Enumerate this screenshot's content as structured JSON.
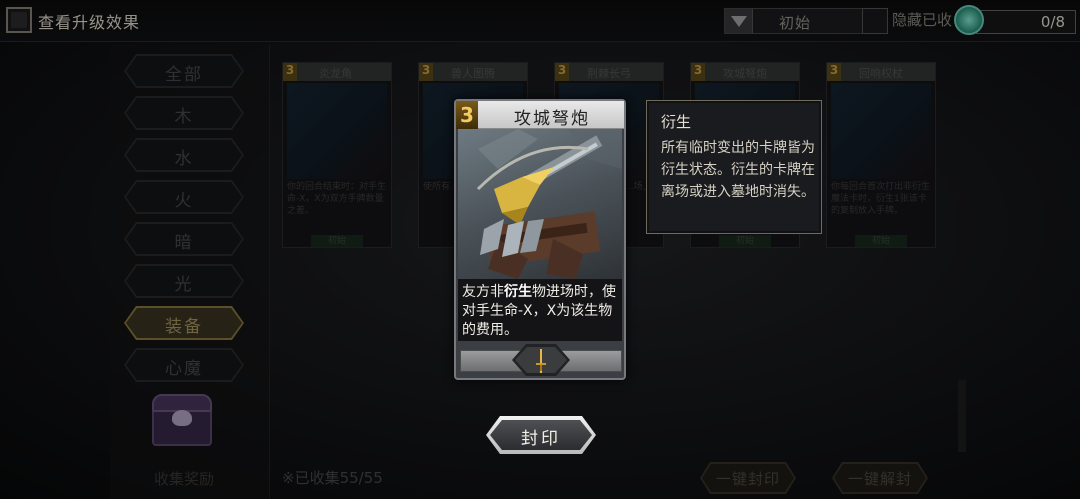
{
  "topbar": {
    "upgrade_label": "查看升级效果",
    "filter_value": "初始",
    "hide_label": "隐藏已收",
    "counter": "0/8"
  },
  "sidebar": {
    "items": [
      {
        "label": "全部",
        "active": false
      },
      {
        "label": "木",
        "active": false
      },
      {
        "label": "水",
        "active": false
      },
      {
        "label": "火",
        "active": false
      },
      {
        "label": "暗",
        "active": false
      },
      {
        "label": "光",
        "active": false
      },
      {
        "label": "装备",
        "active": true
      },
      {
        "label": "心魔",
        "active": false
      }
    ],
    "collect_label": "收集奖励"
  },
  "grid": {
    "cards": [
      {
        "cost": "3",
        "name": "炎龙角",
        "desc": "你的回合结束时：对手生命-X，X为双方手牌数量之差。",
        "tag": "初始"
      },
      {
        "cost": "3",
        "name": "兽人图腾",
        "desc": "使所有...击。",
        "tag": ""
      },
      {
        "cost": "3",
        "name": "荆棘长弓",
        "desc": "...场上",
        "tag": ""
      },
      {
        "cost": "3",
        "name": "攻城弩炮",
        "desc": "",
        "tag": "初始"
      },
      {
        "cost": "3",
        "name": "回响权杖",
        "desc": "你每回合首次打出非衍生魔法卡时，衍生1张该卡的复制放入手牌。",
        "tag": "初始"
      }
    ],
    "collected_label": "※已收集55/55",
    "seal_all_label": "一键封印",
    "unseal_all_label": "一键解封"
  },
  "focus_card": {
    "cost": "3",
    "name": "攻城弩炮",
    "desc_pre": "友方非",
    "desc_keyword": "衍生",
    "desc_post": "物进场时，使对手生命-X，X为该生物的费用。",
    "badge_icon": "sword-icon"
  },
  "tooltip": {
    "title": "衍生",
    "body": "所有临时变出的卡牌皆为衍生状态。衍生的卡牌在离场或进入墓地时消失。"
  },
  "seal_button": {
    "label": "封印"
  },
  "colors": {
    "accent_gold": "#a99a63",
    "gem": "#3aa58f"
  }
}
